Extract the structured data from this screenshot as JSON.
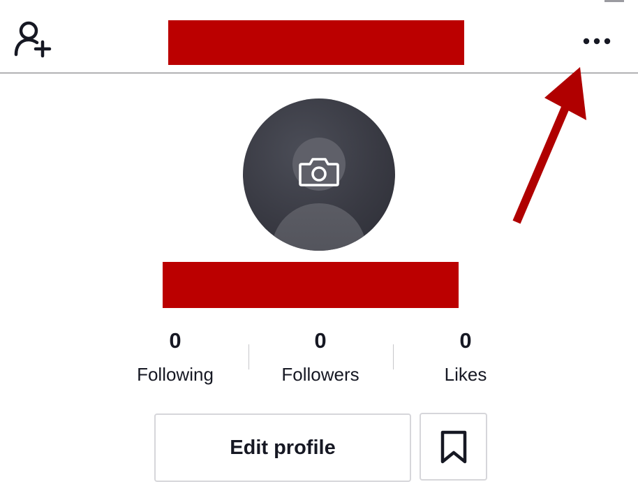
{
  "header": {
    "add_user_icon": "person-add-icon",
    "more_icon": "more-horizontal-icon",
    "title": "",
    "title_redacted": true
  },
  "profile": {
    "avatar_icon": "camera-icon",
    "display_name": "",
    "name_redacted": true
  },
  "stats": [
    {
      "value": "0",
      "label": "Following"
    },
    {
      "value": "0",
      "label": "Followers"
    },
    {
      "value": "0",
      "label": "Likes"
    }
  ],
  "actions": {
    "edit_profile_label": "Edit profile",
    "bookmark_icon": "bookmark-icon"
  },
  "annotation": {
    "arrow_color": "#b00000",
    "points_to": "more-options"
  },
  "colors": {
    "redaction": "#bb0000",
    "text": "#161823",
    "border": "#d6d6da",
    "avatar_bg": "#393a43"
  }
}
